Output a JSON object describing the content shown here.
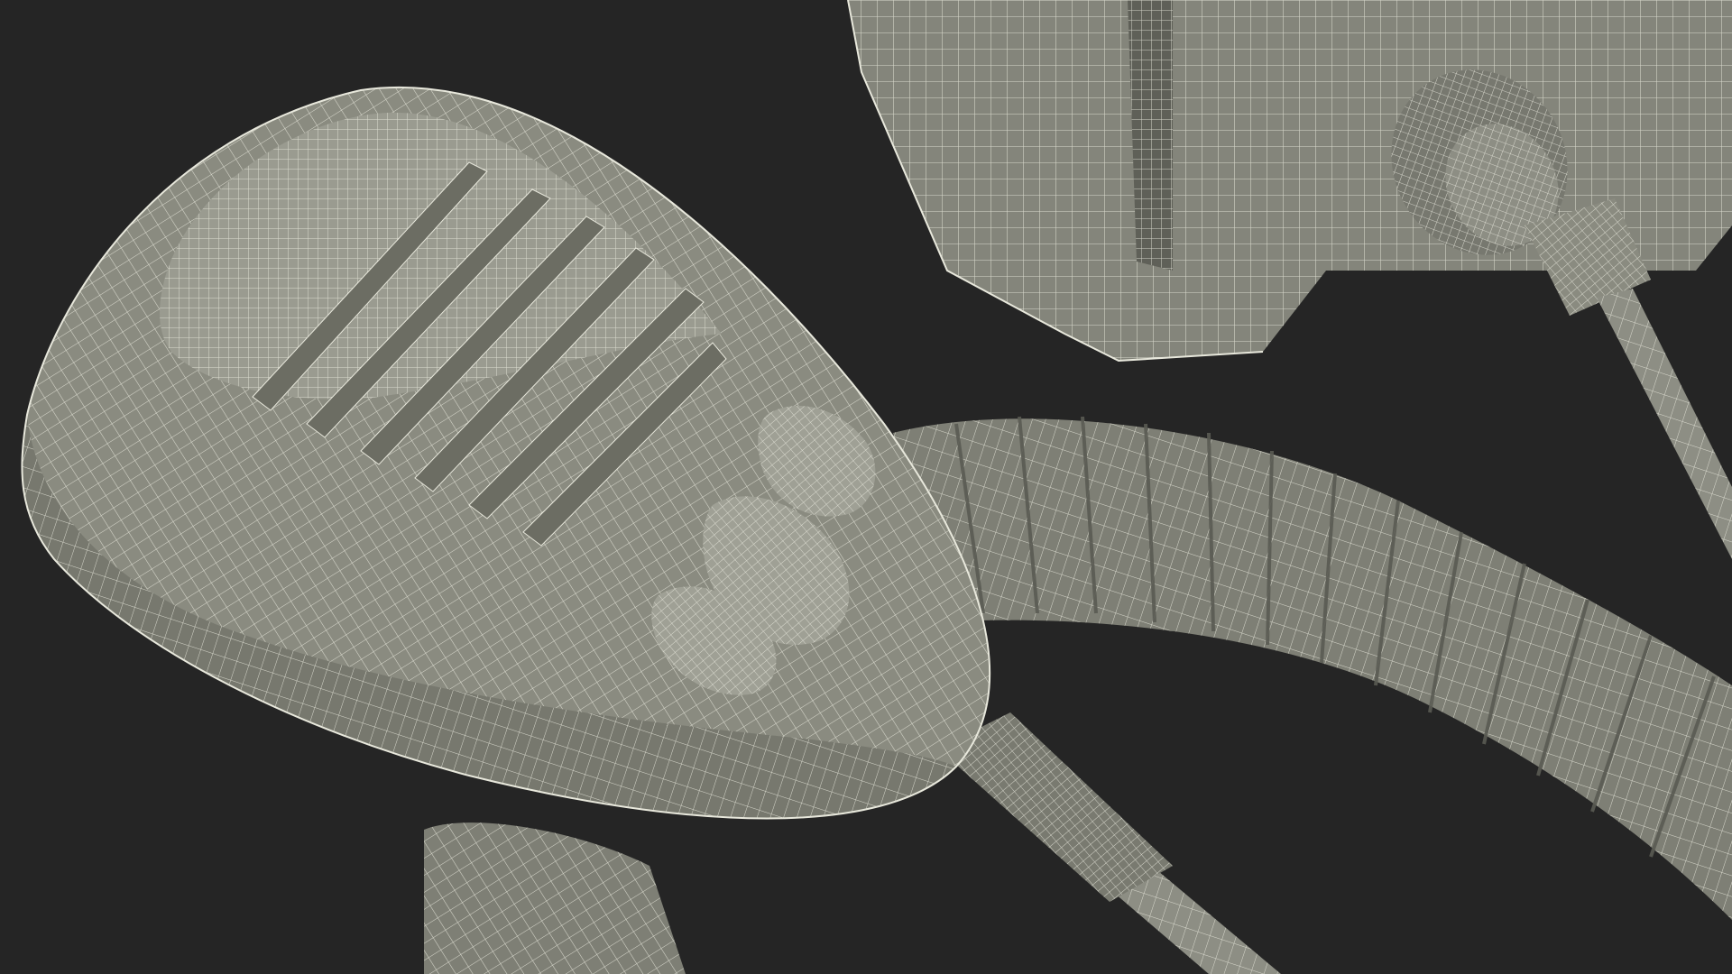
{
  "scene": {
    "subject": "wireframe-render",
    "colors": {
      "background": "#252525",
      "surface": "#8a8b80",
      "surface_light": "#a2a397",
      "surface_dark": "#6c6d63",
      "wire": "#e8e8dc",
      "wire_dim": "#cfd0c4"
    }
  }
}
